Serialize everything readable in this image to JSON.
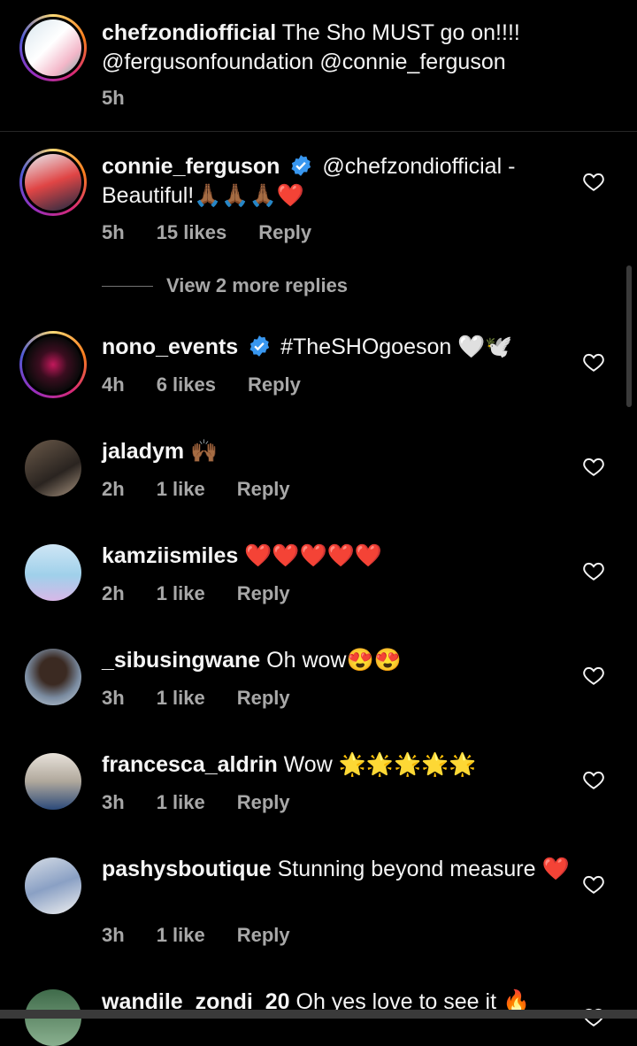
{
  "caption": {
    "user": "chefzondiofficial",
    "text": " The Sho MUST go on!!!! @fergusonfoundation @connie_ferguson",
    "time": "5h"
  },
  "comments": [
    {
      "user": "connie_ferguson",
      "verified": true,
      "text": " @chefzondiofficial - Beautiful!🙏🏾🙏🏾🙏🏾❤️",
      "time": "5h",
      "likes": "15 likes",
      "reply": "Reply",
      "more_replies": "View 2 more replies"
    },
    {
      "user": "nono_events",
      "verified": true,
      "text": " #TheSHOgoeson 🤍🕊️",
      "time": "4h",
      "likes": "6 likes",
      "reply": "Reply"
    },
    {
      "user": "jaladym",
      "verified": false,
      "text": " 🙌🏾",
      "time": "2h",
      "likes": "1 like",
      "reply": "Reply"
    },
    {
      "user": "kamziismiles",
      "verified": false,
      "text": " ❤️❤️❤️❤️❤️",
      "time": "2h",
      "likes": "1 like",
      "reply": "Reply"
    },
    {
      "user": "_sibusingwane",
      "verified": false,
      "text": " Oh wow😍😍",
      "time": "3h",
      "likes": "1 like",
      "reply": "Reply"
    },
    {
      "user": "francesca_aldrin",
      "verified": false,
      "text": " Wow 🌟🌟🌟🌟🌟",
      "time": "3h",
      "likes": "1 like",
      "reply": "Reply"
    },
    {
      "user": "pashysboutique",
      "verified": false,
      "text": " Stunning beyond measure ❤️",
      "time": "3h",
      "likes": "1 like",
      "reply": "Reply"
    },
    {
      "user": "wandile_zondi_20",
      "verified": false,
      "text": " Oh yes love to see it 🔥",
      "time": "",
      "likes": "",
      "reply": ""
    }
  ],
  "icons": {
    "like": "heart-outline-icon",
    "verified": "verified-badge-icon"
  },
  "colors": {
    "background": "#000000",
    "verified": "#3897f0",
    "muted": "#a8a8a8"
  }
}
